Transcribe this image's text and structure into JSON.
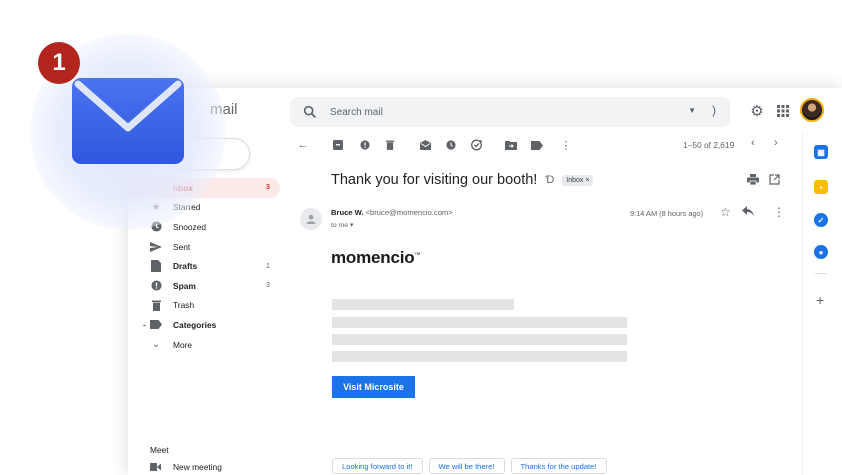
{
  "step": {
    "number": "1"
  },
  "header": {
    "brand_partial": "mail",
    "search_placeholder": "Search mail",
    "help_icon": "help-icon",
    "settings_icon": "gear-icon",
    "apps_icon": "apps-grid-icon"
  },
  "nav": {
    "items": [
      {
        "label": "Inbox",
        "visible_label": "nbox",
        "count": "3",
        "icon": "inbox-icon",
        "active": true
      },
      {
        "label": "Starred",
        "count": "",
        "icon": "star-icon"
      },
      {
        "label": "Snoozed",
        "count": "",
        "icon": "clock-icon"
      },
      {
        "label": "Sent",
        "count": "",
        "icon": "send-icon"
      },
      {
        "label": "Drafts",
        "count": "1",
        "icon": "draft-icon",
        "bold": true
      },
      {
        "label": "Spam",
        "count": "3",
        "icon": "spam-icon",
        "bold": true
      },
      {
        "label": "Trash",
        "count": "",
        "icon": "trash-icon"
      },
      {
        "label": "Categories",
        "count": "",
        "icon": "label-icon",
        "bold": true
      },
      {
        "label": "More",
        "count": "",
        "icon": "chevron-down-icon"
      }
    ],
    "meet_title": "Meet",
    "meet_item": "New meeting"
  },
  "toolbar": {
    "pager": "1–50 of 2,619"
  },
  "message": {
    "subject": "Thank you for visiting our booth!",
    "label": "Inbox ×",
    "sender_name": "Bruce W.",
    "sender_email": "<bruce@momencio.com>",
    "to": "to me ▾",
    "time": "9:14 AM (8 hours ago)",
    "logo": "momencio",
    "logo_tm": "™",
    "cta": "Visit Microsite",
    "smart_replies": [
      "Looking forward to it!",
      "We will be there!",
      "Thanks for the update!"
    ]
  },
  "colors": {
    "accent": "#1a73e8",
    "active_nav_bg": "#fce8e6",
    "active_nav_text": "#d93025",
    "step_badge": "#b3261e",
    "envelope": "#3b63e6"
  }
}
